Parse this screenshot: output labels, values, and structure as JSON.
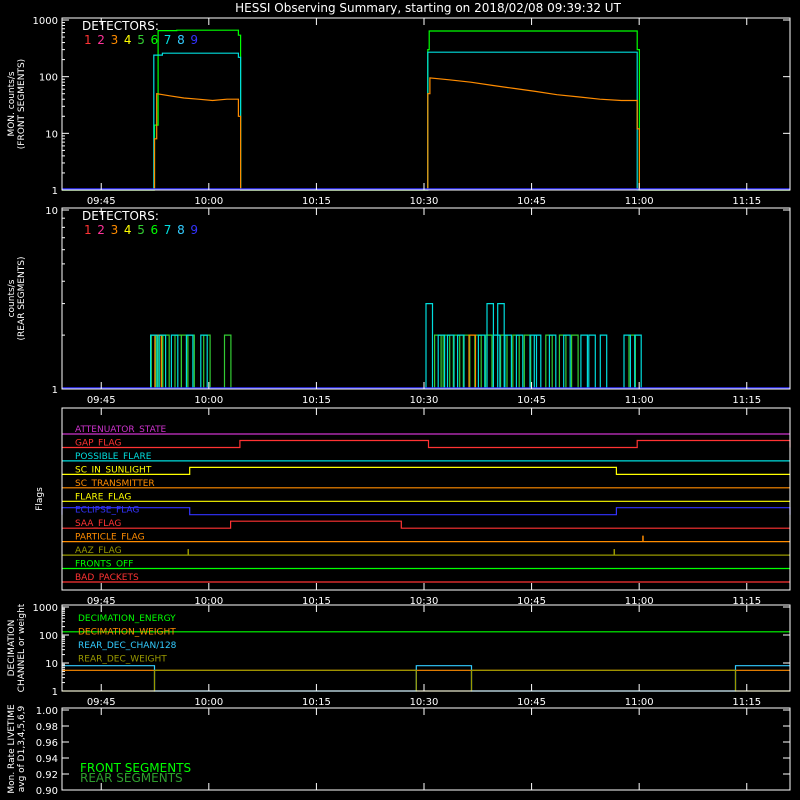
{
  "title": "HESSI Observing Summary, starting on 2018/02/08 09:39:32 UT",
  "time_ticks": [
    "09:45",
    "10:00",
    "10:15",
    "10:30",
    "10:45",
    "11:00",
    "11:15"
  ],
  "time_tick_minutes": [
    5.47,
    20.47,
    35.47,
    50.47,
    65.47,
    80.47,
    95.47
  ],
  "xlim_minutes": [
    0,
    101.5
  ],
  "detectors": {
    "label": "DETECTORS:",
    "numbers": [
      "1",
      "2",
      "3",
      "4",
      "5",
      "6",
      "7",
      "8",
      "9"
    ],
    "colors": [
      "#ff3333",
      "#ff3399",
      "#ff8c00",
      "#ffff00",
      "#33cc33",
      "#00ff00",
      "#00dddd",
      "#33ccff",
      "#3333ff"
    ]
  },
  "chart_data": [
    {
      "id": "front",
      "type": "line",
      "ylabel": [
        "MON. counts/s",
        "(FRONT SEGMENTS)"
      ],
      "yscale": "log",
      "ylim": [
        1,
        1000
      ],
      "ytick_labels": [
        "1",
        "10",
        "100",
        "1000"
      ],
      "ytick_values": [
        1,
        10,
        100,
        1000
      ],
      "series": [
        {
          "color": "#00ff00",
          "points": [
            [
              0,
              1
            ],
            [
              12.9,
              1
            ],
            [
              12.9,
              14
            ],
            [
              13.4,
              14
            ],
            [
              13.4,
              650
            ],
            [
              16,
              650
            ],
            [
              16,
              660
            ],
            [
              24.6,
              660
            ],
            [
              24.6,
              540
            ],
            [
              24.9,
              540
            ],
            [
              24.9,
              1
            ],
            [
              51,
              1
            ],
            [
              51,
              300
            ],
            [
              51.2,
              300
            ],
            [
              51.2,
              640
            ],
            [
              80.2,
              640
            ],
            [
              80.2,
              300
            ],
            [
              80.5,
              300
            ],
            [
              80.5,
              1
            ],
            [
              101.5,
              1
            ]
          ]
        },
        {
          "color": "#00dddd",
          "points": [
            [
              0,
              1
            ],
            [
              12.8,
              1
            ],
            [
              12.8,
              240
            ],
            [
              14,
              240
            ],
            [
              14,
              260
            ],
            [
              24.6,
              260
            ],
            [
              24.6,
              220
            ],
            [
              24.9,
              220
            ],
            [
              24.9,
              1
            ],
            [
              51,
              1
            ],
            [
              51,
              270
            ],
            [
              80.2,
              270
            ],
            [
              80.2,
              1
            ],
            [
              101.5,
              1
            ]
          ]
        },
        {
          "color": "#ff8c00",
          "points": [
            [
              0,
              1
            ],
            [
              12.9,
              1
            ],
            [
              12.9,
              8
            ],
            [
              13.2,
              8
            ],
            [
              13.2,
              50
            ],
            [
              15,
              46
            ],
            [
              17,
              42
            ],
            [
              19,
              40
            ],
            [
              21,
              38
            ],
            [
              23,
              40
            ],
            [
              24.6,
              40
            ],
            [
              24.6,
              20
            ],
            [
              24.9,
              20
            ],
            [
              24.9,
              1
            ],
            [
              51,
              1
            ],
            [
              51,
              50
            ],
            [
              51.3,
              50
            ],
            [
              51.3,
              95
            ],
            [
              54,
              88
            ],
            [
              57,
              80
            ],
            [
              60,
              70
            ],
            [
              63,
              62
            ],
            [
              66,
              55
            ],
            [
              69,
              48
            ],
            [
              72,
              44
            ],
            [
              75,
              40
            ],
            [
              78,
              38
            ],
            [
              80.2,
              38
            ],
            [
              80.2,
              12
            ],
            [
              80.5,
              12
            ],
            [
              80.5,
              1
            ],
            [
              101.5,
              1
            ]
          ]
        }
      ]
    },
    {
      "id": "rear",
      "type": "line",
      "ylabel": [
        "counts/s",
        "(REAR SEGMENTS)"
      ],
      "yscale": "log",
      "ylim": [
        1,
        10
      ],
      "ytick_labels": [
        "1",
        "10"
      ],
      "ytick_values": [
        1,
        10
      ],
      "series": [
        {
          "color": "#33cc33",
          "spikes": [
            [
              12.9,
              2
            ],
            [
              13.5,
              2
            ],
            [
              14.5,
              2
            ],
            [
              16.2,
              2
            ],
            [
              17.1,
              2
            ],
            [
              18.0,
              2
            ],
            [
              20.2,
              2
            ],
            [
              23.1,
              2
            ],
            [
              52.4,
              2
            ],
            [
              53.6,
              2
            ],
            [
              55.0,
              2
            ],
            [
              56.4,
              2
            ],
            [
              58.0,
              2
            ],
            [
              59.5,
              2
            ],
            [
              61.6,
              2
            ],
            [
              63.3,
              2
            ],
            [
              64.9,
              2
            ],
            [
              67.9,
              2
            ],
            [
              69.8,
              2
            ],
            [
              71.5,
              2
            ],
            [
              79.5,
              2
            ]
          ]
        },
        {
          "color": "#ff8c00",
          "spikes": [
            [
              13.4,
              2
            ],
            [
              57.2,
              2
            ]
          ]
        },
        {
          "color": "#00dddd",
          "spikes": [
            [
              12.8,
              2
            ],
            [
              14.0,
              2
            ],
            [
              15.7,
              2
            ],
            [
              17.8,
              2
            ],
            [
              19.8,
              2
            ],
            [
              51.2,
              3
            ],
            [
              52.9,
              2
            ],
            [
              54.2,
              2
            ],
            [
              55.6,
              2
            ],
            [
              58.5,
              2
            ],
            [
              59.7,
              3
            ],
            [
              60.6,
              2
            ],
            [
              61.2,
              3
            ],
            [
              62.2,
              2
            ],
            [
              63.8,
              2
            ],
            [
              65.7,
              2
            ],
            [
              66.3,
              2
            ],
            [
              68.4,
              2
            ],
            [
              70.4,
              2
            ],
            [
              72.8,
              2
            ],
            [
              73.9,
              2
            ],
            [
              75.5,
              2
            ],
            [
              78.8,
              2
            ],
            [
              80.3,
              2
            ]
          ]
        }
      ],
      "baseline_color": "#3333ff"
    },
    {
      "id": "flags",
      "type": "step",
      "ylabel": [
        "Flags"
      ],
      "flags": [
        {
          "name": "ATTENUATOR_STATE",
          "color": "#cc33cc",
          "high": []
        },
        {
          "name": "GAP_FLAG",
          "color": "#ff3333",
          "high": [
            [
              24.8,
              51.1
            ],
            [
              80.2,
              101.5
            ]
          ]
        },
        {
          "name": "POSSIBLE_FLARE",
          "color": "#00dddd",
          "high": []
        },
        {
          "name": "SC_IN_SUNLIGHT",
          "color": "#ffff00",
          "high": [
            [
              17.8,
              77.3
            ]
          ]
        },
        {
          "name": "SC_TRANSMITTER",
          "color": "#ff8c00",
          "high": []
        },
        {
          "name": "FLARE_FLAG",
          "color": "#ffff00",
          "high": []
        },
        {
          "name": "ECLIPSE_FLAG",
          "color": "#3333ff",
          "high": [
            [
              0,
              17.8
            ],
            [
              77.3,
              101.5
            ]
          ]
        },
        {
          "name": "SAA_FLAG",
          "color": "#ff3333",
          "high": [
            [
              23.5,
              47.3
            ]
          ]
        },
        {
          "name": "PARTICLE_FLAG",
          "color": "#ff8c00",
          "spike": [
            81.0
          ]
        },
        {
          "name": "AAZ_FLAG",
          "color": "#999900",
          "spike": [
            17.6,
            77.0
          ]
        },
        {
          "name": "FRONTS_OFF",
          "color": "#00ff00",
          "high": []
        },
        {
          "name": "BAD_PACKETS",
          "color": "#ff3333",
          "high": []
        }
      ]
    },
    {
      "id": "decimation",
      "type": "step",
      "ylabel": [
        "DECIMATION",
        "CHANNEL or weight"
      ],
      "yscale": "log",
      "ylim": [
        1,
        1000
      ],
      "ytick_labels": [
        "1",
        "10",
        "100",
        "1000"
      ],
      "ytick_values": [
        1,
        10,
        100,
        1000
      ],
      "series": [
        {
          "name": "DECIMATION_ENERGY",
          "color": "#00ff00",
          "points": [
            [
              0,
              130
            ],
            [
              101.5,
              130
            ]
          ]
        },
        {
          "name": "DECIMATION_WEIGHT",
          "color": "#ff8c00",
          "points": [
            [
              0,
              5.5
            ],
            [
              101.5,
              5.5
            ]
          ]
        },
        {
          "name": "REAR_DEC_CHAN/128",
          "color": "#33ccff",
          "points": [
            [
              0,
              8
            ],
            [
              12.9,
              8
            ],
            [
              12.9,
              1
            ],
            [
              49.4,
              1
            ],
            [
              49.4,
              8
            ],
            [
              57.1,
              8
            ],
            [
              57.1,
              1
            ],
            [
              93.9,
              1
            ],
            [
              93.9,
              8
            ],
            [
              101.5,
              8
            ]
          ]
        },
        {
          "name": "REAR_DEC_WEIGHT",
          "color": "#999900",
          "points": [
            [
              0,
              1
            ],
            [
              12.9,
              1
            ],
            [
              12.9,
              5.5
            ],
            [
              49.4,
              5.5
            ],
            [
              49.4,
              1
            ],
            [
              57.1,
              1
            ],
            [
              57.1,
              5.5
            ],
            [
              93.9,
              5.5
            ],
            [
              93.9,
              1
            ],
            [
              101.5,
              1
            ]
          ]
        }
      ]
    },
    {
      "id": "livetime",
      "type": "line",
      "ylabel": [
        "Mon. Rate LIVETIME",
        "avg of D1,3,4,5,6,9"
      ],
      "ylim": [
        0.9,
        1.0
      ],
      "ytick_labels": [
        "0.90",
        "0.92",
        "0.94",
        "0.96",
        "0.98",
        "1.00"
      ],
      "ytick_values": [
        0.9,
        0.92,
        0.94,
        0.96,
        0.98,
        1.0
      ],
      "legend": [
        {
          "name": "FRONT SEGMENTS",
          "color": "#00ff00"
        },
        {
          "name": "REAR SEGMENTS",
          "color": "#2e9e2e"
        }
      ],
      "series": []
    }
  ]
}
